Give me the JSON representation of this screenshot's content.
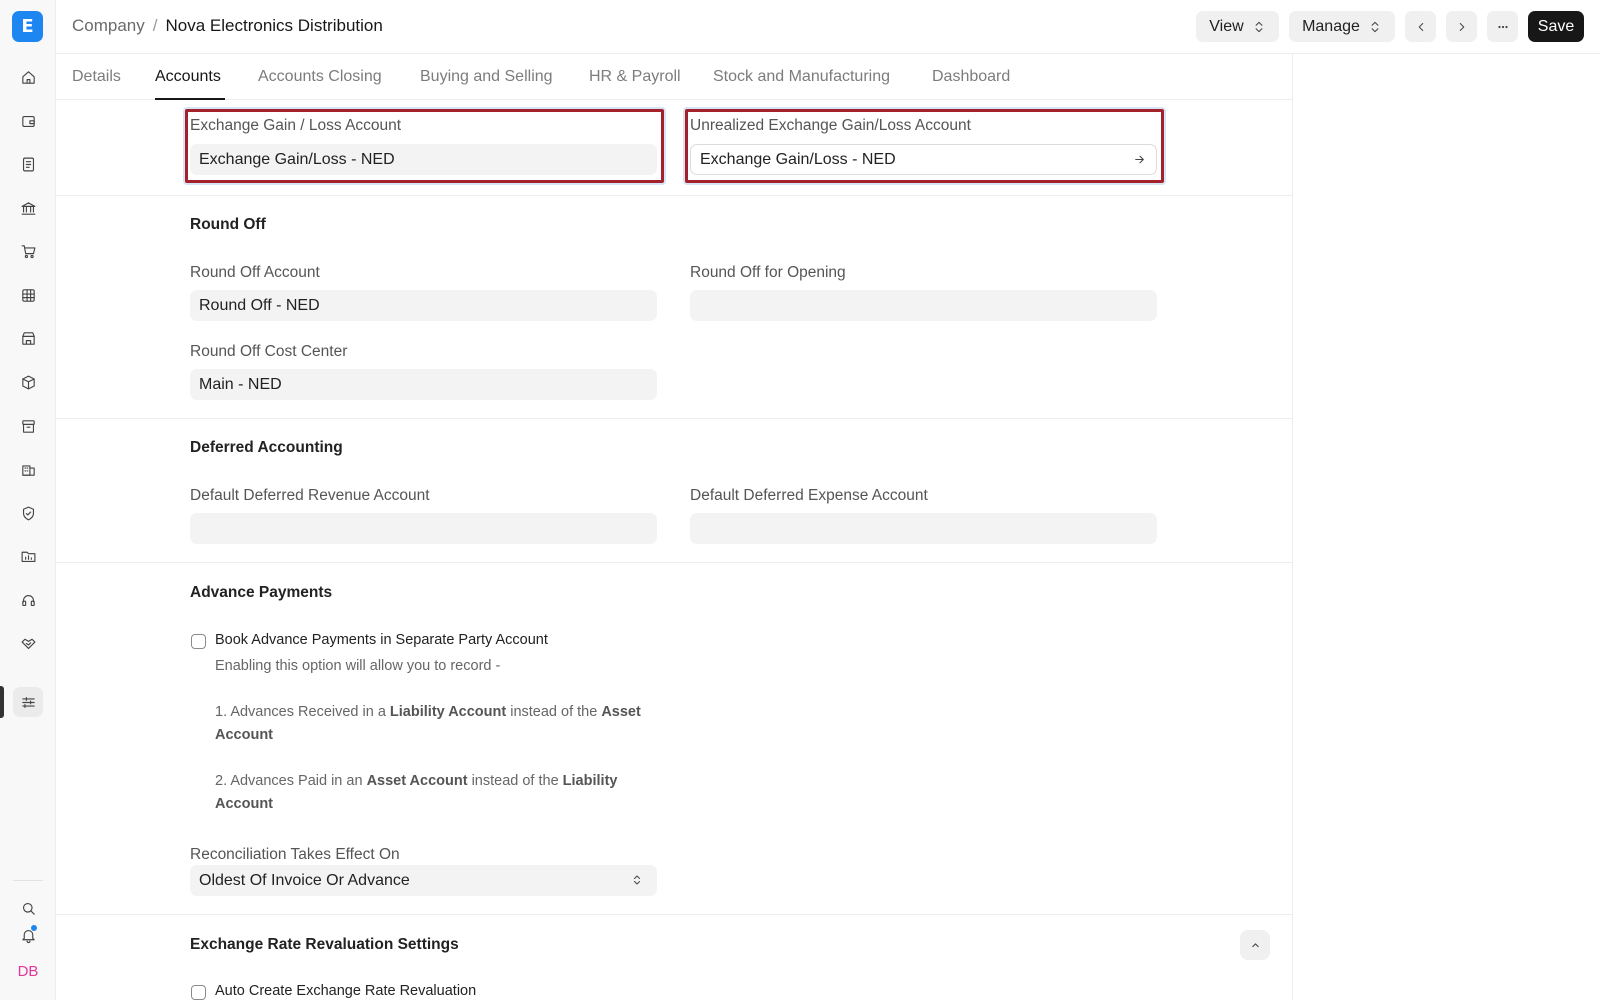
{
  "sidebar": {
    "logo_letter": "E",
    "icons": [
      "home-icon",
      "wallet-icon",
      "document-icon",
      "bank-icon",
      "cart-icon",
      "table-icon",
      "store-icon",
      "box-icon",
      "archive-icon",
      "building-icon",
      "shield-icon",
      "folder-chart-icon",
      "headset-icon",
      "handshake-icon",
      "sliders-icon"
    ],
    "bottom_icons": [
      "search-icon",
      "bell-icon"
    ],
    "avatar_initials": "DB",
    "accent_color": "#1e86f0"
  },
  "header": {
    "breadcrumb_parent": "Company",
    "breadcrumb_separator": "/",
    "title": "Nova Electronics Distribution",
    "view_label": "View",
    "manage_label": "Manage",
    "save_label": "Save"
  },
  "tabs": [
    "Details",
    "Accounts",
    "Accounts Closing",
    "Buying and Selling",
    "HR & Payroll",
    "Stock and Manufacturing",
    "Dashboard"
  ],
  "active_tab": "Accounts",
  "exchange": {
    "gain_loss_label": "Exchange Gain / Loss Account",
    "gain_loss_value": "Exchange Gain/Loss - NED",
    "unrealized_label": "Unrealized Exchange Gain/Loss Account",
    "unrealized_value": "Exchange Gain/Loss - NED",
    "highlight_color": "#a3212b"
  },
  "round_off": {
    "title": "Round Off",
    "account_label": "Round Off Account",
    "account_value": "Round Off - NED",
    "opening_label": "Round Off for Opening",
    "opening_value": "",
    "cost_center_label": "Round Off Cost Center",
    "cost_center_value": "Main - NED"
  },
  "deferred": {
    "title": "Deferred Accounting",
    "revenue_label": "Default Deferred Revenue Account",
    "revenue_value": "",
    "expense_label": "Default Deferred Expense Account",
    "expense_value": ""
  },
  "advance": {
    "title": "Advance Payments",
    "checkbox_label": "Book Advance Payments in Separate Party Account",
    "desc_intro": "Enabling this option will allow you to record -",
    "desc_1_a": "1. Advances Received in a ",
    "desc_1_b": "Liability Account",
    "desc_1_c": " instead of the ",
    "desc_1_d": "Asset Account",
    "desc_2_a": "2. Advances Paid in an ",
    "desc_2_b": "Asset Account",
    "desc_2_c": " instead of the ",
    "desc_2_d": "Liability Account",
    "reconciliation_label": "Reconciliation Takes Effect On",
    "reconciliation_value": "Oldest Of Invoice Or Advance"
  },
  "revaluation": {
    "title": "Exchange Rate Revaluation Settings",
    "checkbox_label": "Auto Create Exchange Rate Revaluation"
  }
}
